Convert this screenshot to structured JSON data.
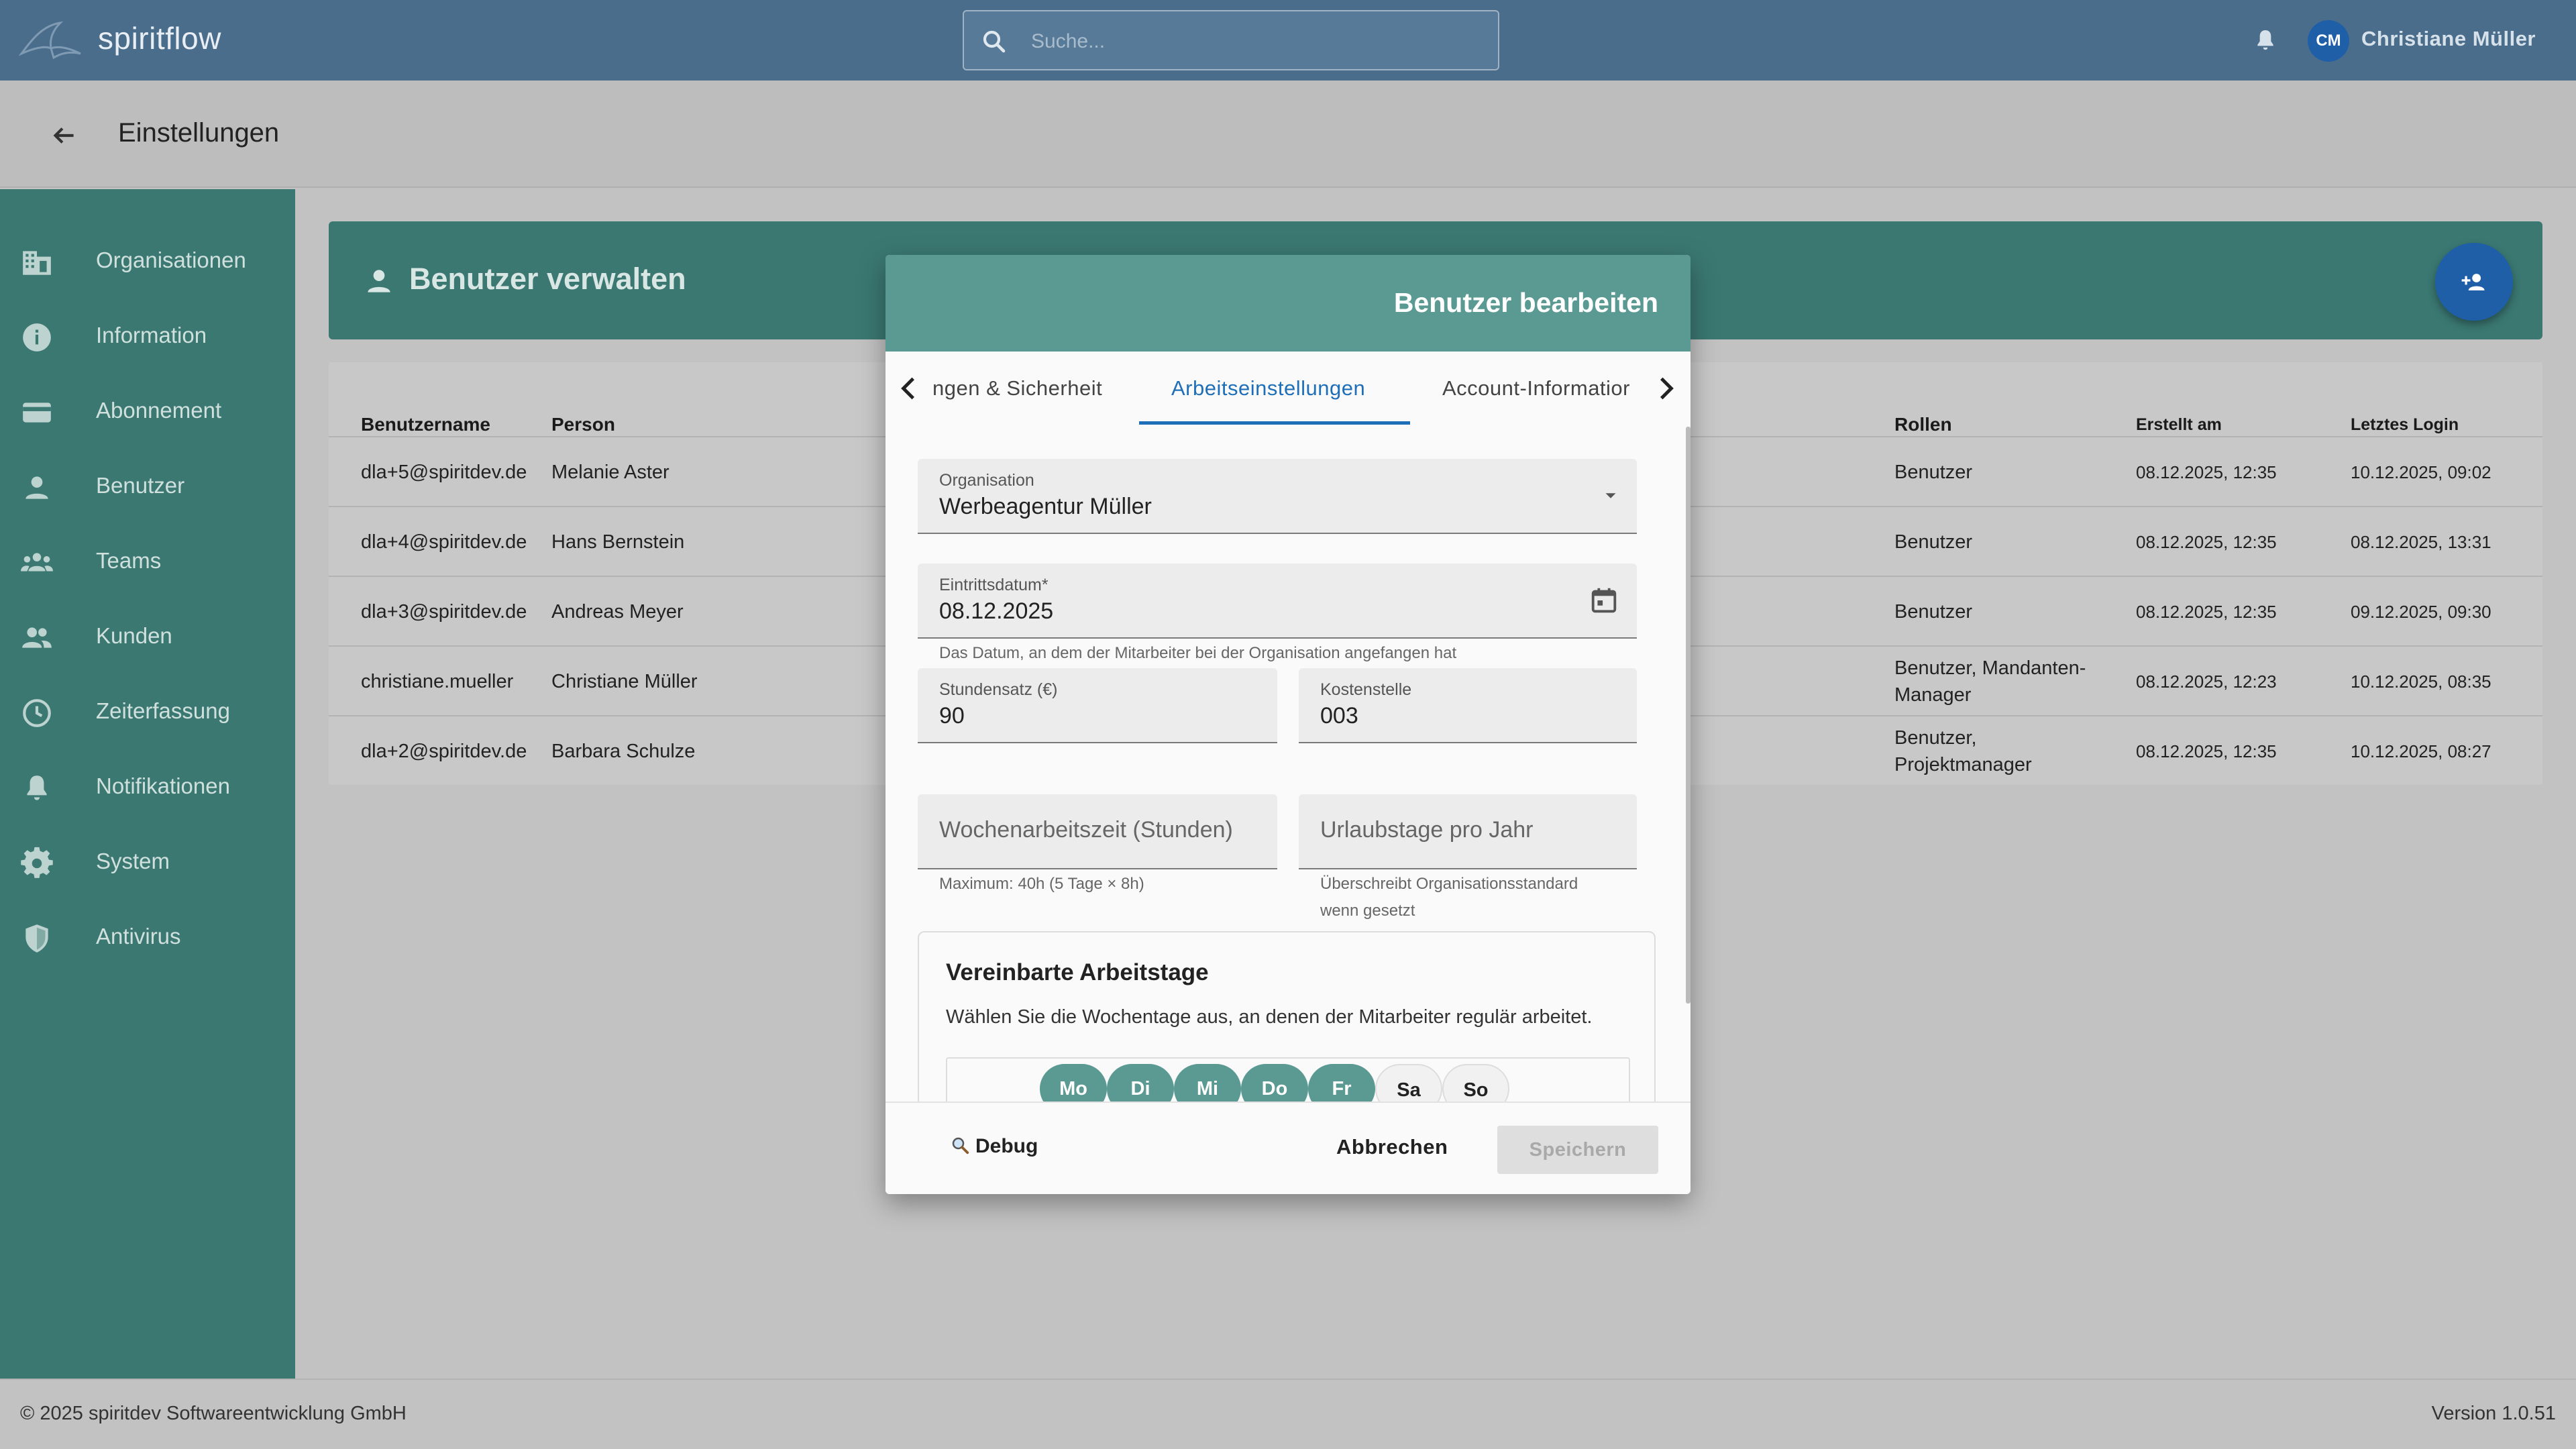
{
  "app": {
    "brand": "spiritflow",
    "search_placeholder": "Suche...",
    "user_initials": "CM",
    "user_name": "Christiane Müller",
    "page_title": "Einstellungen"
  },
  "sidebar": {
    "items": [
      {
        "label": "Organisationen",
        "icon": "building-icon"
      },
      {
        "label": "Information",
        "icon": "info-icon"
      },
      {
        "label": "Abonnement",
        "icon": "credit-card-icon"
      },
      {
        "label": "Benutzer",
        "icon": "person-icon"
      },
      {
        "label": "Teams",
        "icon": "group-icon"
      },
      {
        "label": "Kunden",
        "icon": "people-icon"
      },
      {
        "label": "Zeiterfassung",
        "icon": "clock-icon"
      },
      {
        "label": "Notifikationen",
        "icon": "bell-icon"
      },
      {
        "label": "System",
        "icon": "gear-icon"
      },
      {
        "label": "Antivirus",
        "icon": "shield-icon"
      }
    ]
  },
  "panel": {
    "title": "Benutzer verwalten"
  },
  "table": {
    "headers": {
      "username": "Benutzername",
      "person": "Person",
      "roles": "Rollen",
      "created": "Erstellt am",
      "last_login": "Letztes Login"
    },
    "rows": [
      {
        "username": "dla+5@spiritdev.de",
        "person": "Melanie Aster",
        "roles": "Benutzer",
        "created": "08.12.2025, 12:35",
        "last_login": "10.12.2025, 09:02"
      },
      {
        "username": "dla+4@spiritdev.de",
        "person": "Hans Bernstein",
        "roles": "Benutzer",
        "created": "08.12.2025, 12:35",
        "last_login": "08.12.2025, 13:31"
      },
      {
        "username": "dla+3@spiritdev.de",
        "person": "Andreas Meyer",
        "roles": "Benutzer",
        "created": "08.12.2025, 12:35",
        "last_login": "09.12.2025, 09:30"
      },
      {
        "username": "christiane.mueller",
        "person": "Christiane Müller",
        "roles": "Benutzer, Mandanten-Manager",
        "created": "08.12.2025, 12:23",
        "last_login": "10.12.2025, 08:35"
      },
      {
        "username": "dla+2@spiritdev.de",
        "person": "Barbara Schulze",
        "roles": "Benutzer, Projektmanager",
        "created": "08.12.2025, 12:35",
        "last_login": "10.12.2025, 08:27"
      }
    ]
  },
  "dialog": {
    "title": "Benutzer bearbeiten",
    "tabs": [
      "ngen & Sicherheit",
      "Arbeitseinstellungen",
      "Account-Informatior"
    ],
    "active_tab": "Arbeitseinstellungen",
    "organisation": {
      "label": "Organisation",
      "value": "Werbeagentur Müller"
    },
    "entry_date": {
      "label": "Eintrittsdatum*",
      "value": "08.12.2025",
      "hint": "Das Datum, an dem der Mitarbeiter bei der Organisation angefangen hat"
    },
    "hourly_rate": {
      "label": "Stundensatz (€)",
      "value": "90"
    },
    "cost_center": {
      "label": "Kostenstelle",
      "value": "003"
    },
    "weekly_hours": {
      "placeholder": "Wochenarbeitszeit (Stunden)",
      "hint": "Maximum: 40h (5 Tage × 8h)"
    },
    "vacation_days": {
      "placeholder": "Urlaubstage pro Jahr",
      "hint": "Überschreibt Organisationsstandard wenn gesetzt"
    },
    "workdays": {
      "title": "Vereinbarte Arbeitstage",
      "description": "Wählen Sie die Wochentage aus, an denen der Mitarbeiter regulär arbeitet.",
      "days": [
        {
          "label": "Mo",
          "selected": true
        },
        {
          "label": "Di",
          "selected": true
        },
        {
          "label": "Mi",
          "selected": true
        },
        {
          "label": "Do",
          "selected": true
        },
        {
          "label": "Fr",
          "selected": true
        },
        {
          "label": "Sa",
          "selected": false
        },
        {
          "label": "So",
          "selected": false
        }
      ]
    },
    "debug_label": "Debug",
    "cancel_label": "Abbrechen",
    "save_label": "Speichern"
  },
  "footer": {
    "copyright": "© 2025 spiritdev Softwareentwicklung GmbH",
    "version": "Version 1.0.51"
  },
  "colors": {
    "topbar": "#4a6d8c",
    "teal": "#3b7872",
    "dialog_header": "#5a9a92",
    "accent_blue": "#1f6fb8",
    "fab": "#1f5fa8"
  }
}
